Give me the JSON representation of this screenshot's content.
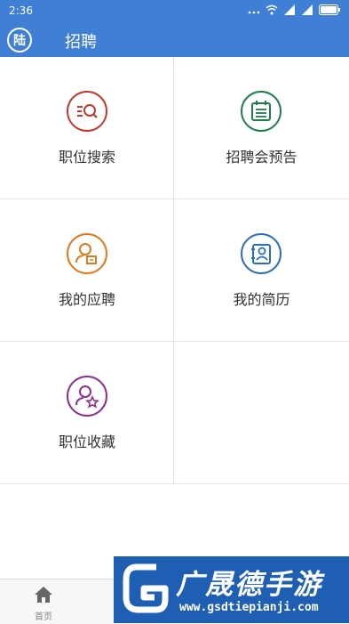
{
  "status_bar": {
    "time": "2:36"
  },
  "app_bar": {
    "logo_text": "陆",
    "title": "招聘"
  },
  "grid": {
    "items": [
      {
        "label": "职位搜索",
        "icon": "search-list-icon",
        "color": "#c0392b"
      },
      {
        "label": "招聘会预告",
        "icon": "calendar-icon",
        "color": "#1e7d4a"
      },
      {
        "label": "我的应聘",
        "icon": "user-card-icon",
        "color": "#e07b1d"
      },
      {
        "label": "我的简历",
        "icon": "resume-icon",
        "color": "#2d6fb5"
      },
      {
        "label": "职位收藏",
        "icon": "user-star-icon",
        "color": "#8e2f8e"
      }
    ]
  },
  "bottom_nav": {
    "home_label": "首页"
  },
  "watermark": {
    "text": "广晟德手游",
    "url": "www.gsdtiepianji.com"
  },
  "colors": {
    "primary": "#3f7fd6"
  }
}
